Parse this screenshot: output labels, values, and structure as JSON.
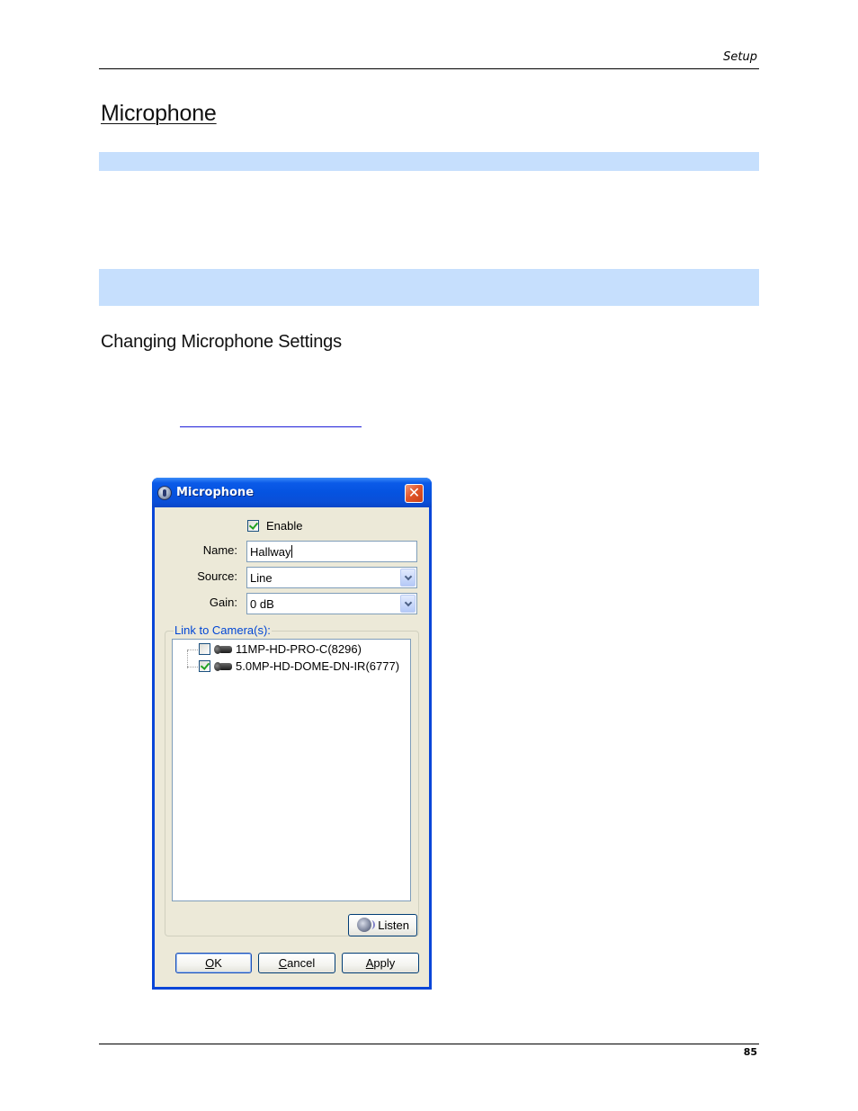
{
  "page": {
    "running_header": "Setup",
    "section_title": "Microphone",
    "subsection_title": "Changing Microphone Settings",
    "page_number": "85"
  },
  "colors": {
    "highlight_band": "#c6dffd",
    "xp_title_blue": "#0553e0",
    "dialog_face": "#ece9d8",
    "group_label": "#0046d5",
    "link_blue": "#1f1fd8"
  },
  "dialog": {
    "title": "Microphone",
    "title_icon": "info-icon",
    "close_glyph": "✕",
    "enable": {
      "label": "Enable",
      "checked": true
    },
    "name": {
      "label": "Name:",
      "value": "Hallway"
    },
    "source": {
      "label": "Source:",
      "value": "Line"
    },
    "gain": {
      "label": "Gain:",
      "value": "0 dB"
    },
    "camera_group": {
      "label": "Link to Camera(s):",
      "cameras": [
        {
          "name": "11MP-HD-PRO-C(8296)",
          "checked": false,
          "icon": "camera-icon"
        },
        {
          "name": "5.0MP-HD-DOME-DN-IR(6777)",
          "checked": true,
          "icon": "camera-icon"
        }
      ]
    },
    "buttons": {
      "listen": "Listen",
      "ok_mnemonic": "O",
      "ok_rest": "K",
      "cancel_mnemonic": "C",
      "cancel_rest": "ancel",
      "apply_mnemonic": "A",
      "apply_rest": "pply"
    }
  }
}
